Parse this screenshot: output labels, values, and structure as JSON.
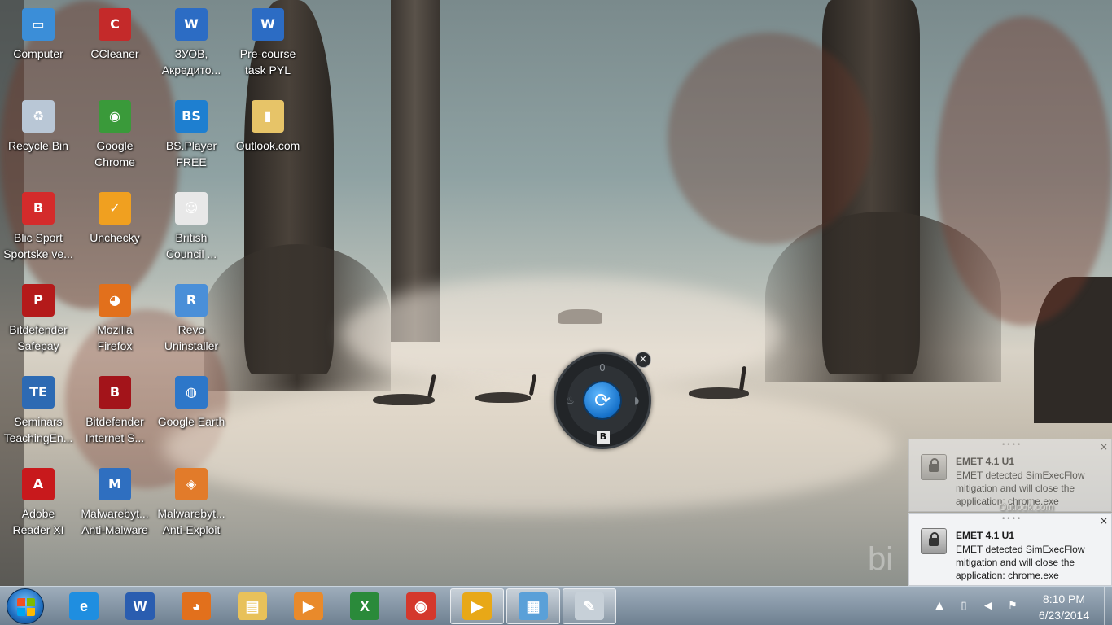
{
  "desktop": {
    "icons": [
      {
        "name": "computer-icon",
        "label": "Computer",
        "color": "#3b8ed8",
        "glyph": "▭"
      },
      {
        "name": "recycle-bin-icon",
        "label": "Recycle Bin",
        "color": "#b9c7d6",
        "glyph": "♻"
      },
      {
        "name": "blic-sport-icon",
        "label": "Blic Sport\nSportske ve...",
        "color": "#d42b2b",
        "glyph": "B"
      },
      {
        "name": "bitdefender-safepay-icon",
        "label": "Bitdefender\nSafepay",
        "color": "#b41a1a",
        "glyph": "P"
      },
      {
        "name": "seminars-icon",
        "label": "Seminars\nTeachingEn...",
        "color": "#2d6ab3",
        "glyph": "TE"
      },
      {
        "name": "adobe-reader-icon",
        "label": "Adobe\nReader XI",
        "color": "#c8191c",
        "glyph": "A"
      },
      {
        "name": "ccleaner-icon",
        "label": "CCleaner",
        "color": "#c42a2a",
        "glyph": "C"
      },
      {
        "name": "google-chrome-icon",
        "label": "Google\nChrome",
        "color": "#3a9a3a",
        "glyph": "◉"
      },
      {
        "name": "unchecky-icon",
        "label": "Unchecky",
        "color": "#f0a020",
        "glyph": "✓"
      },
      {
        "name": "mozilla-firefox-icon",
        "label": "Mozilla\nFirefox",
        "color": "#e2701c",
        "glyph": "◕"
      },
      {
        "name": "bitdefender-internet-security-icon",
        "label": "Bitdefender\nInternet S...",
        "color": "#a3141a",
        "glyph": "B"
      },
      {
        "name": "malwarebytes-anti-malware-icon",
        "label": "Malwarebyt...\nAnti-Malware",
        "color": "#2f6fc0",
        "glyph": "M"
      },
      {
        "name": "zuov-document-icon",
        "label": "ЗУОВ,\nАкредито...",
        "color": "#2c6cc4",
        "glyph": "W"
      },
      {
        "name": "bsplayer-icon",
        "label": "BS.Player\nFREE",
        "color": "#1e7fd0",
        "glyph": "BS"
      },
      {
        "name": "british-council-icon",
        "label": "British\nCouncil ...",
        "color": "#e8e8e8",
        "glyph": "☺"
      },
      {
        "name": "revo-uninstaller-icon",
        "label": "Revo\nUninstaller",
        "color": "#4a8fd8",
        "glyph": "R"
      },
      {
        "name": "google-earth-icon",
        "label": "Google Earth",
        "color": "#2d77c9",
        "glyph": "◍"
      },
      {
        "name": "malwarebytes-anti-exploit-icon",
        "label": "Malwarebyt...\nAnti-Exploit",
        "color": "#e27b2a",
        "glyph": "◈"
      },
      {
        "name": "pre-course-task-icon",
        "label": "Pre-course\ntask PYL",
        "color": "#2c6cc4",
        "glyph": "W"
      },
      {
        "name": "outlook-folder-icon",
        "label": "Outlook.com",
        "color": "#e7c468",
        "glyph": "▮"
      }
    ]
  },
  "gadget": {
    "top_value": "0",
    "badge": "B",
    "center_icon": "refresh-icon",
    "close": "×"
  },
  "notifications": [
    {
      "title": "EMET 4.1 U1",
      "body": "EMET detected SimExecFlow mitigation and will close the application: chrome.exe",
      "close": "×",
      "overlay_text": "Outlook.com"
    },
    {
      "title": "EMET 4.1 U1",
      "body": "EMET detected SimExecFlow mitigation and will close the application: chrome.exe",
      "close": "×"
    }
  ],
  "watermark": "bi",
  "taskbar": {
    "pinned": [
      {
        "name": "internet-explorer-taskbar-button",
        "glyph": "e",
        "color": "#1f8ee0"
      },
      {
        "name": "word-taskbar-button",
        "glyph": "W",
        "color": "#2a5db0"
      },
      {
        "name": "firefox-taskbar-button",
        "glyph": "◕",
        "color": "#e2701c"
      },
      {
        "name": "explorer-taskbar-button",
        "glyph": "▤",
        "color": "#e8c15a"
      },
      {
        "name": "media-player-taskbar-button",
        "glyph": "▶",
        "color": "#e98a2b"
      },
      {
        "name": "excel-taskbar-button",
        "glyph": "X",
        "color": "#2a8a3a"
      },
      {
        "name": "chrome-taskbar-button",
        "glyph": "◉",
        "color": "#d4382c"
      },
      {
        "name": "plex-taskbar-button",
        "glyph": "▶",
        "color": "#e8a817"
      },
      {
        "name": "control-panel-taskbar-button",
        "glyph": "▦",
        "color": "#5aa0d8"
      },
      {
        "name": "paint-taskbar-button",
        "glyph": "✎",
        "color": "#c7d0d8"
      }
    ],
    "active_index": 7,
    "tray": {
      "arrow": "▲",
      "clock_time": "8:10 PM",
      "clock_date": "6/23/2014"
    }
  }
}
